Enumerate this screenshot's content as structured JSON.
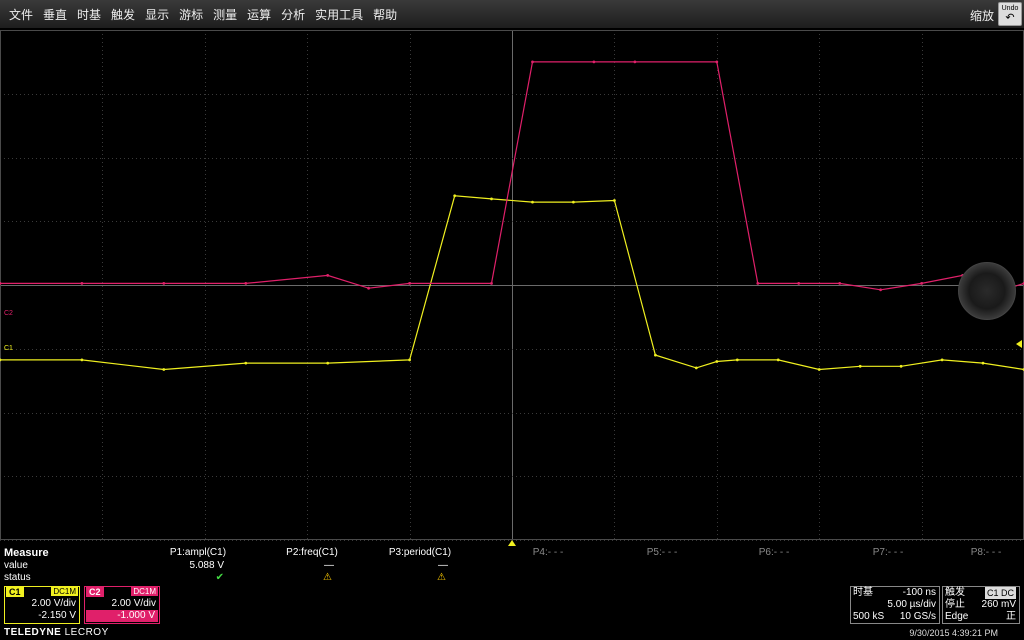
{
  "menu": {
    "items": [
      "文件",
      "垂直",
      "时基",
      "触发",
      "显示",
      "游标",
      "测量",
      "运算",
      "分析",
      "实用工具",
      "帮助"
    ],
    "zoom_label": "缩放",
    "undo_label": "Undo"
  },
  "markers": {
    "c2_label": "C2",
    "c1_label": "C1"
  },
  "colors": {
    "c1": "#f0f020",
    "c2": "#e0206a",
    "grid": "#3a3a3a",
    "background": "#000000"
  },
  "chart_data": {
    "type": "line",
    "grid": true,
    "divisions": {
      "x": 10,
      "y": 8
    },
    "xlim": [
      -25.1,
      24.9
    ],
    "xunit": "µs",
    "series": [
      {
        "name": "C1",
        "color": "#f0f020",
        "x": [
          -25.1,
          -21.1,
          -17.1,
          -13.1,
          -9.1,
          -5.1,
          -2.9,
          -1.1,
          0.9,
          2.9,
          4.9,
          6.9,
          8.9,
          9.9,
          10.9,
          12.9,
          14.9,
          16.9,
          18.9,
          20.9,
          22.9,
          24.9
        ],
        "y": [
          -0.2,
          -0.2,
          -0.5,
          -0.3,
          -0.3,
          -0.2,
          4.95,
          4.85,
          4.75,
          4.75,
          4.8,
          -0.05,
          -0.45,
          -0.25,
          -0.2,
          -0.2,
          -0.5,
          -0.4,
          -0.4,
          -0.2,
          -0.3,
          -0.5
        ]
      },
      {
        "name": "C2",
        "color": "#e0206a",
        "x": [
          -25.1,
          -21.1,
          -17.1,
          -13.1,
          -9.1,
          -7.1,
          -5.1,
          -1.1,
          0.9,
          3.9,
          5.9,
          9.9,
          11.9,
          13.9,
          15.9,
          17.9,
          19.9,
          21.9,
          23.9,
          24.9
        ],
        "y": [
          1.05,
          1.05,
          1.05,
          1.05,
          1.3,
          0.9,
          1.05,
          1.05,
          8.0,
          8.0,
          8.0,
          8.0,
          1.05,
          1.05,
          1.05,
          0.85,
          1.05,
          1.3,
          0.85,
          1.05
        ]
      }
    ],
    "offsets": {
      "C1": -2.15,
      "C2": -1.0
    },
    "volts_per_div": {
      "C1": 2.0,
      "C2": 2.0
    },
    "us_per_div": 5.0
  },
  "measure": {
    "title": "Measure",
    "row_value": "value",
    "row_status": "status",
    "p1": {
      "name": "P1:ampl(C1)",
      "value": "5.088 V",
      "status": "✔"
    },
    "p2": {
      "name": "P2:freq(C1)",
      "value": "—",
      "status": "⚠"
    },
    "p3": {
      "name": "P3:period(C1)",
      "value": "—",
      "status": "⚠"
    },
    "p4": {
      "name": "P4:- - -"
    },
    "p5": {
      "name": "P5:- - -"
    },
    "p6": {
      "name": "P6:- - -"
    },
    "p7": {
      "name": "P7:- - -"
    },
    "p8": {
      "name": "P8:- - -"
    }
  },
  "channels": {
    "c1": {
      "tag": "C1",
      "coupling": "DC1M",
      "scale": "2.00 V/div",
      "offset": "-2.150 V"
    },
    "c2": {
      "tag": "C2",
      "coupling": "DC1M",
      "scale": "2.00 V/div",
      "offset": "-1.000 V"
    }
  },
  "timebase": {
    "label": "时基",
    "delay": "-100 ns",
    "scale": "5.00 µs/div",
    "samples": "500 kS",
    "rate": "10 GS/s"
  },
  "trigger": {
    "label": "触发",
    "source": "C1 DC",
    "mode": "停止",
    "level": "260 mV",
    "type": "Edge",
    "slope": "正"
  },
  "footer": {
    "brand_bold": "TELEDYNE",
    "brand_thin": "LECROY",
    "datetime": "9/30/2015 4:39:21 PM"
  }
}
